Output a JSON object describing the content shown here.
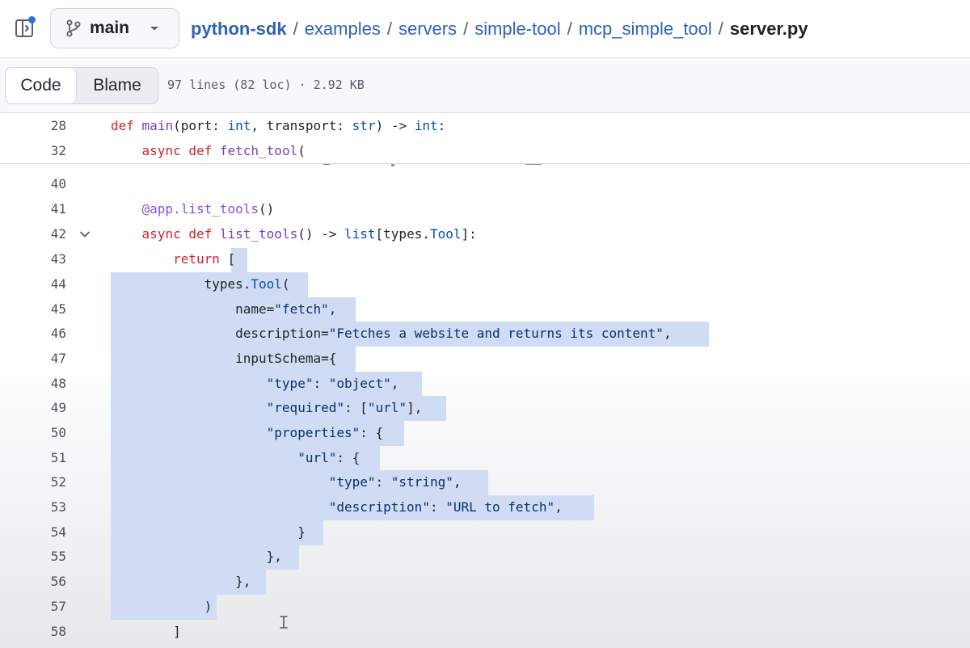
{
  "topbar": {
    "branch": "main",
    "breadcrumb": {
      "repo": "python-sdk",
      "dirs": [
        "examples",
        "servers",
        "simple-tool",
        "mcp_simple_tool"
      ],
      "separator": "/",
      "file": "server.py"
    }
  },
  "filebar": {
    "code_tab": "Code",
    "blame_tab": "Blame",
    "meta": "97 lines (82 loc) · 2.92 KB"
  },
  "sticky": [
    {
      "num": "28",
      "text": "def main(port: int, transport: str) -> int:"
    },
    {
      "num": "32",
      "text": "    async def fetch_tool("
    }
  ],
  "lines": [
    {
      "num": "40",
      "text": ""
    },
    {
      "num": "41",
      "text": "    @app.list_tools()"
    },
    {
      "num": "42",
      "text": "    async def list_tools() -> list[types.Tool]:",
      "fold": true
    },
    {
      "num": "43",
      "text": "        return ["
    },
    {
      "num": "44",
      "text": "            types.Tool("
    },
    {
      "num": "45",
      "text": "                name=\"fetch\","
    },
    {
      "num": "46",
      "text": "                description=\"Fetches a website and returns its content\","
    },
    {
      "num": "47",
      "text": "                inputSchema={"
    },
    {
      "num": "48",
      "text": "                    \"type\": \"object\","
    },
    {
      "num": "49",
      "text": "                    \"required\": [\"url\"],"
    },
    {
      "num": "50",
      "text": "                    \"properties\": {"
    },
    {
      "num": "51",
      "text": "                        \"url\": {"
    },
    {
      "num": "52",
      "text": "                            \"type\": \"string\","
    },
    {
      "num": "53",
      "text": "                            \"description\": \"URL to fetch\","
    },
    {
      "num": "54",
      "text": "                        }"
    },
    {
      "num": "55",
      "text": "                    },"
    },
    {
      "num": "56",
      "text": "                },"
    },
    {
      "num": "57",
      "text": "            )"
    },
    {
      "num": "58",
      "text": "        ]"
    }
  ],
  "colors": {
    "selection": "#cfdcf3",
    "keyword": "#cf222e",
    "builtin": "#0550ae",
    "link": "#2f63b6",
    "notification_dot": "#2f6fe4"
  },
  "icons": [
    "sidebar-toggle-icon",
    "git-branch-icon",
    "chevron-down-icon",
    "fold-chevron-icon",
    "text-cursor-icon"
  ]
}
